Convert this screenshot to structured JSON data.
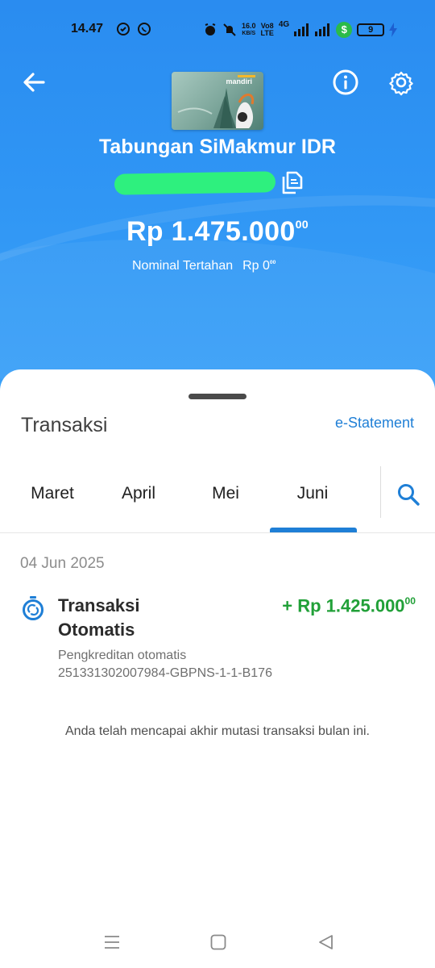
{
  "status_bar": {
    "time": "14.47",
    "speed_top": "16.0",
    "speed_bottom": "KB/S",
    "volte_top": "Vo8",
    "volte_bottom": "LTE",
    "network": "4G",
    "money_symbol": "$",
    "battery": "9"
  },
  "account": {
    "card_brand": "mandiri",
    "title": "Tabungan SiMakmur IDR",
    "balance_main": "Rp 1.475.000",
    "balance_cents": "00",
    "hold_label": "Nominal Tertahan",
    "hold_value_main": "Rp 0",
    "hold_value_cents": "00"
  },
  "transactions": {
    "title": "Transaksi",
    "estatement_label": "e-Statement",
    "tabs": [
      {
        "label": "Maret"
      },
      {
        "label": "April"
      },
      {
        "label": "Mei"
      },
      {
        "label": "Juni",
        "active": true
      }
    ],
    "date": "04 Jun 2025",
    "item": {
      "title_line1": "Transaksi",
      "title_line2": "Otomatis",
      "amount_main": "+ Rp 1.425.000",
      "amount_cents": "00",
      "desc_line1": "Pengkreditan otomatis",
      "desc_line2": "251331302007984-GBPNS-1-1-B176"
    },
    "end_note": "Anda telah mencapai akhir mutasi transaksi bulan ini."
  },
  "colors": {
    "header_blue": "#2f95f4",
    "accent_blue": "#1f7fd6",
    "credit_green": "#21a038",
    "mask_green": "#2ef07e"
  },
  "icons": [
    "back-arrow-icon",
    "info-icon",
    "gear-icon",
    "copy-icon",
    "search-icon",
    "stopwatch-icon",
    "menu-icon",
    "home-square-icon",
    "back-triangle-icon"
  ]
}
